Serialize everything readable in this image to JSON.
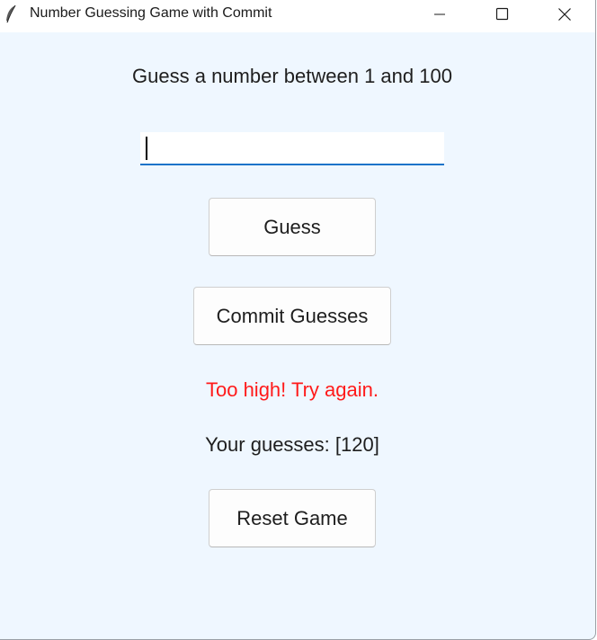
{
  "window": {
    "title": "Number Guessing Game with Commit",
    "icon": "feather-icon",
    "controls": [
      "minimize-icon",
      "maximize-icon",
      "close-icon"
    ]
  },
  "game": {
    "prompt": "Guess a number between 1 and 100",
    "input_value": "",
    "guess_button": "Guess",
    "commit_button": "Commit Guesses",
    "status_message": "Too high! Try again.",
    "guesses_text": "Your guesses: [120]",
    "reset_button": "Reset Game"
  },
  "colors": {
    "background": "#eff7ff",
    "status": "#ff1a1a",
    "input_underline": "#1a73c9"
  }
}
